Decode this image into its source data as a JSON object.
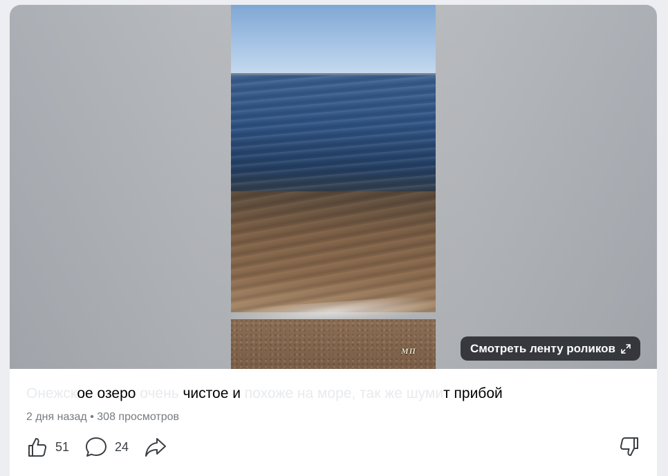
{
  "video": {
    "watermark": "МП",
    "feed_button_label": "Смотреть ленту роликов",
    "feed_button_icon": "expand-icon"
  },
  "post": {
    "title_parts": [
      {
        "text": "Онежское озеро очень чистое и похоже на море, так же шумит прибой",
        "visible": false
      },
      {
        "text": "ое озеро",
        "visible": true
      },
      {
        "text": " очень ",
        "visible": false
      },
      {
        "text": "чистое и",
        "visible": true
      },
      {
        "text": " похоже на море, так же шум",
        "visible": false
      },
      {
        "text": "т прибой",
        "visible": true
      }
    ],
    "title": {
      "hidden_start": "Онежск",
      "part1": "ое озеро",
      "hidden_mid1": " очень ",
      "part2": "чистое и",
      "hidden_mid2": " похоже на море, так же шуми",
      "part3": "т прибой"
    },
    "time_ago": "2 дня назад",
    "separator": "•",
    "views": "308 просмотров"
  },
  "actions": {
    "likes": "51",
    "comments": "24",
    "like_icon": "thumbs-up-icon",
    "comment_icon": "comment-bubble-icon",
    "share_icon": "share-arrow-icon",
    "dislike_icon": "thumbs-down-icon"
  },
  "colors": {
    "page_background": "#eceef1",
    "card_background": "#ffffff",
    "overlay_button": "#26282c",
    "meta_text": "#767b80"
  }
}
